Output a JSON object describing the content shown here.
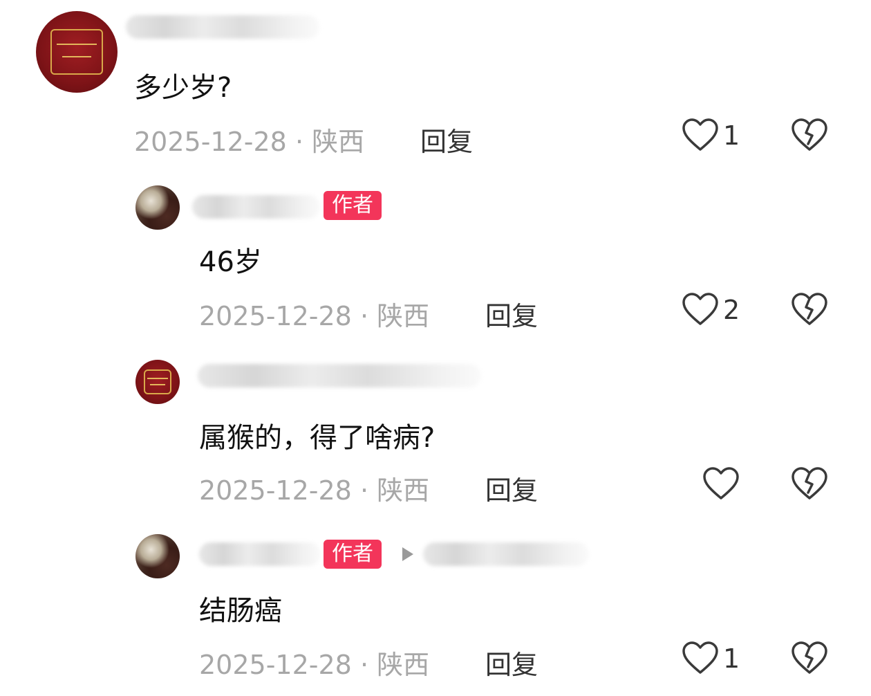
{
  "comments": [
    {
      "text": "多少岁?",
      "date": "2025-12-28",
      "separator": "·",
      "location": "陕西",
      "reply_label": "回复",
      "likes": "1",
      "is_author": false
    },
    {
      "author_badge": "作者",
      "text": "46岁",
      "date": "2025-12-28",
      "separator": "·",
      "location": "陕西",
      "reply_label": "回复",
      "likes": "2",
      "is_author": true
    },
    {
      "text": "属猴的，得了啥病?",
      "date": "2025-12-28",
      "separator": "·",
      "location": "陕西",
      "reply_label": "回复",
      "likes": "",
      "is_author": false
    },
    {
      "author_badge": "作者",
      "text": "结肠癌",
      "date": "2025-12-28",
      "separator": "·",
      "location": "陕西",
      "reply_label": "回复",
      "likes": "1",
      "is_author": true
    }
  ],
  "icons": {
    "like": "heart-outline-icon",
    "dislike": "broken-heart-icon",
    "reply_to": "triangle-right-icon"
  },
  "colors": {
    "author_badge_bg": "#f3355a",
    "meta_gray": "#a7a7a7",
    "avatar_red": "#7d1317"
  }
}
